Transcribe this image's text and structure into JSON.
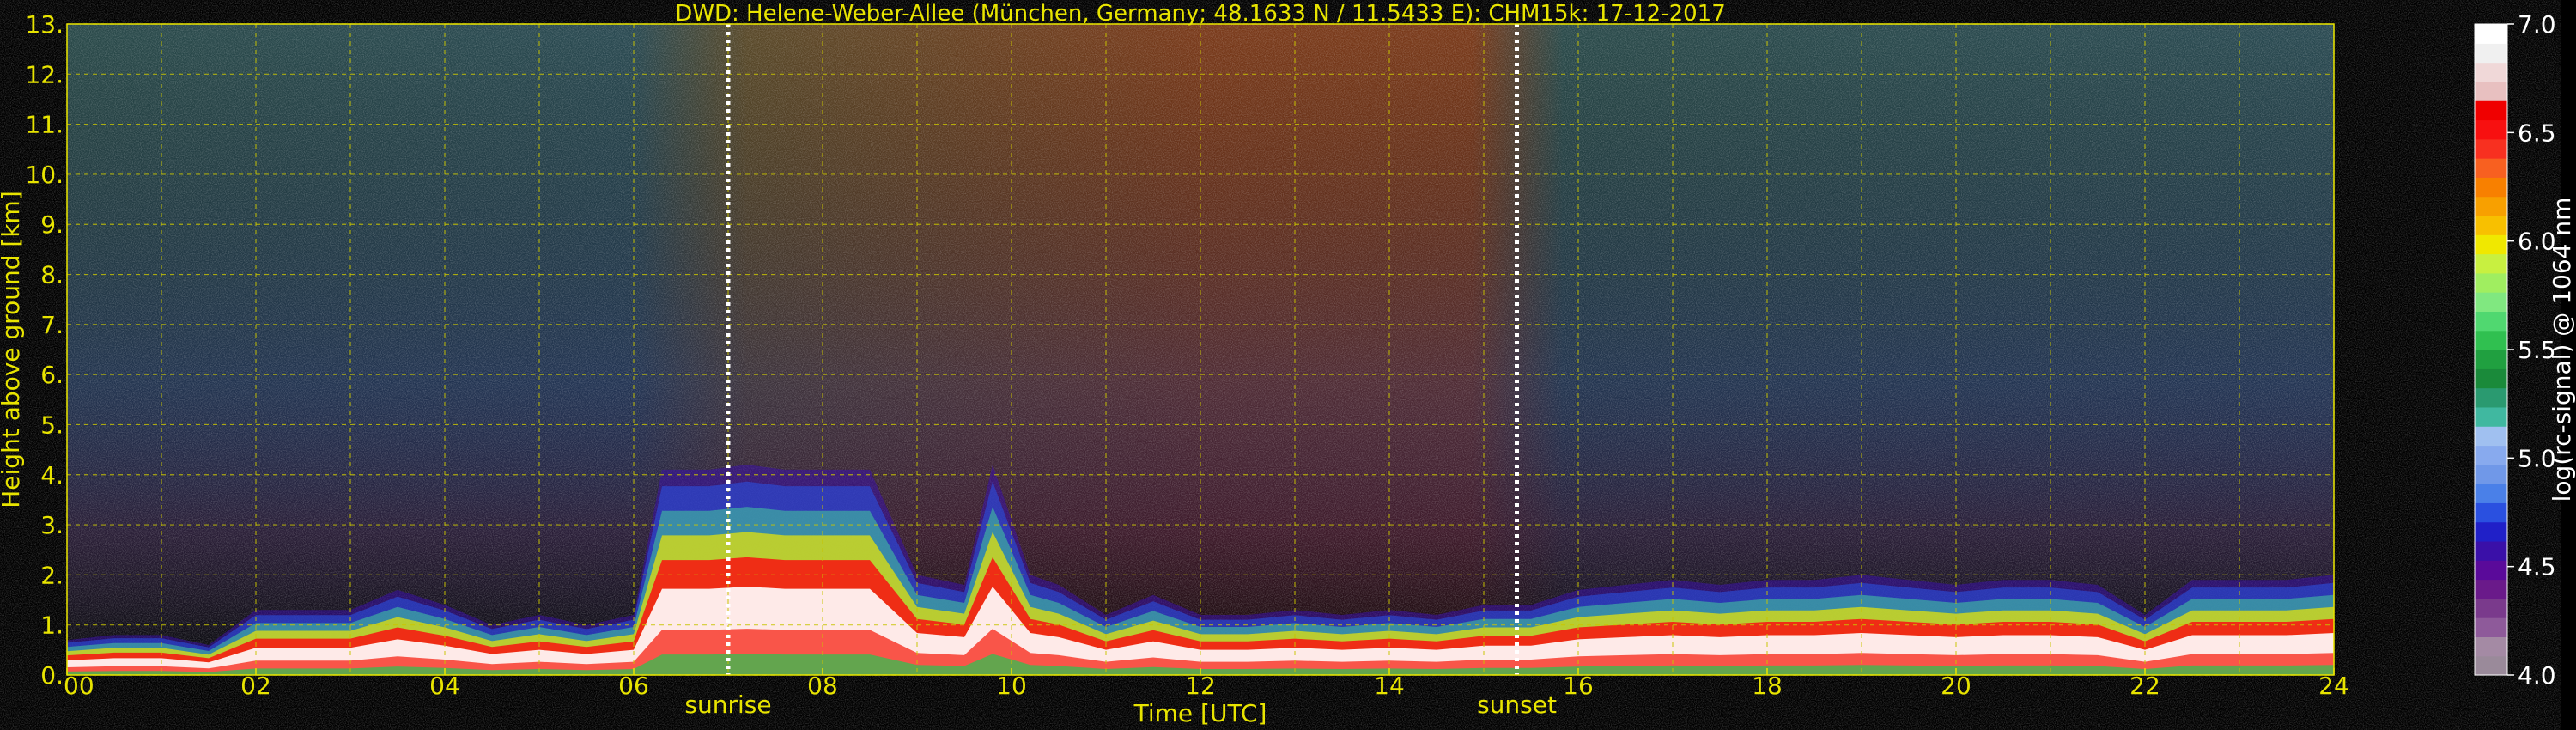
{
  "chart_data": {
    "type": "heatmap",
    "title": "DWD: Helene-Weber-Allee (München, Germany; 48.1633 N / 11.5433 E):     CHM15k: 17-12-2017",
    "xlabel": "Time [UTC]",
    "ylabel": "Height above ground [km]",
    "xlim": [
      0,
      24
    ],
    "ylim": [
      0,
      13
    ],
    "x_ticks": [
      "00",
      "02",
      "04",
      "06",
      "08",
      "10",
      "12",
      "14",
      "16",
      "18",
      "20",
      "22",
      "24"
    ],
    "y_ticks": [
      "0.",
      "1.",
      "2.",
      "3.",
      "4.",
      "5.",
      "6.",
      "7.",
      "8.",
      "9.",
      "10.",
      "11.",
      "12.",
      "13."
    ],
    "grid": true,
    "markers": [
      {
        "label": "sunrise",
        "x": 7.0
      },
      {
        "label": "sunset",
        "x": 15.35
      }
    ],
    "colorbar": {
      "label": "log(rc-signal) @ 1064 nm",
      "range": [
        4.0,
        7.0
      ],
      "ticks": [
        "4.0",
        "4.5",
        "5.0",
        "5.5",
        "6.0",
        "6.5",
        "7.0"
      ],
      "colors": [
        "#9a8a9a",
        "#a48aa4",
        "#8e5a9a",
        "#7a3a8c",
        "#6a1a8a",
        "#5a0a9a",
        "#3a10a8",
        "#2020c8",
        "#2a50e0",
        "#4a80e8",
        "#7098e8",
        "#88aaee",
        "#a0c0f0",
        "#40b8a0",
        "#2a9a70",
        "#1a8a3a",
        "#20a040",
        "#30c050",
        "#50d870",
        "#80e880",
        "#a0ee60",
        "#c8f040",
        "#f0e800",
        "#f8c000",
        "#f8a000",
        "#f88000",
        "#f86020",
        "#f83020",
        "#f81010",
        "#f00000",
        "#e8c0c0",
        "#f0d8d8",
        "#f0f0f0",
        "#ffffff"
      ]
    },
    "background_signal": {
      "description_free": true,
      "cloud_top_profile_km": [
        [
          0.0,
          0.7
        ],
        [
          0.5,
          0.8
        ],
        [
          1.0,
          0.8
        ],
        [
          1.5,
          0.6
        ],
        [
          2.0,
          1.3
        ],
        [
          2.5,
          1.3
        ],
        [
          3.0,
          1.3
        ],
        [
          3.5,
          1.7
        ],
        [
          4.0,
          1.4
        ],
        [
          4.5,
          1.0
        ],
        [
          5.0,
          1.2
        ],
        [
          5.5,
          1.0
        ],
        [
          6.0,
          1.2
        ],
        [
          6.3,
          4.1
        ],
        [
          6.8,
          4.1
        ],
        [
          7.2,
          4.2
        ],
        [
          7.6,
          4.1
        ],
        [
          8.0,
          4.1
        ],
        [
          8.5,
          4.1
        ],
        [
          9.0,
          2.0
        ],
        [
          9.5,
          1.8
        ],
        [
          9.8,
          4.2
        ],
        [
          10.2,
          2.0
        ],
        [
          10.5,
          1.8
        ],
        [
          11.0,
          1.2
        ],
        [
          11.5,
          1.6
        ],
        [
          12.0,
          1.2
        ],
        [
          12.5,
          1.2
        ],
        [
          13.0,
          1.3
        ],
        [
          13.5,
          1.2
        ],
        [
          14.0,
          1.3
        ],
        [
          14.5,
          1.2
        ],
        [
          15.0,
          1.4
        ],
        [
          15.5,
          1.4
        ],
        [
          16.0,
          1.7
        ],
        [
          16.5,
          1.8
        ],
        [
          17.0,
          1.9
        ],
        [
          17.5,
          1.8
        ],
        [
          18.0,
          1.9
        ],
        [
          18.5,
          1.9
        ],
        [
          19.0,
          2.0
        ],
        [
          19.5,
          1.9
        ],
        [
          20.0,
          1.8
        ],
        [
          20.5,
          1.9
        ],
        [
          21.0,
          1.9
        ],
        [
          21.5,
          1.8
        ],
        [
          22.0,
          1.2
        ],
        [
          22.5,
          1.9
        ],
        [
          23.0,
          1.9
        ],
        [
          23.5,
          1.9
        ],
        [
          24.0,
          2.0
        ]
      ]
    }
  }
}
